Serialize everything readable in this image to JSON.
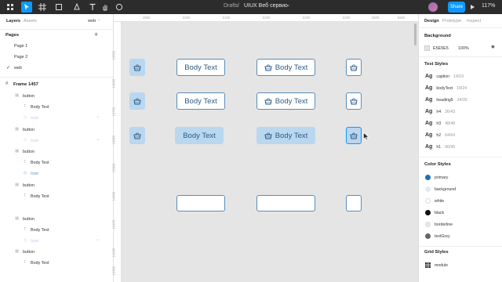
{
  "topbar": {
    "breadcrumb_drafts": "Drafts",
    "breadcrumb_sep": "/",
    "file_name": "UIUX Веб сервис",
    "share_label": "Share",
    "zoom": "117%",
    "chevron": "⌄"
  },
  "left_panel": {
    "tab_layers": "Layers",
    "tab_assets": "Assets",
    "current_page": "web",
    "pages_title": "Pages",
    "add": "+",
    "pages": [
      "Page 1",
      "Page 2",
      "web"
    ],
    "frame_name": "Frame 1457",
    "layers": [
      {
        "type": "button",
        "label": "button"
      },
      {
        "type": "text",
        "label": "Body Text"
      },
      {
        "type": "icon",
        "label": "Icon"
      },
      {
        "type": "button",
        "label": "button"
      },
      {
        "type": "icon",
        "label": "Icon"
      },
      {
        "type": "button",
        "label": "button"
      },
      {
        "type": "text",
        "label": "Body Text"
      },
      {
        "type": "icon",
        "label": "Icon"
      },
      {
        "type": "button",
        "label": "button"
      },
      {
        "type": "text",
        "label": "Body Text"
      },
      {
        "type": "button",
        "label": "button"
      },
      {
        "type": "text",
        "label": "Body Text"
      },
      {
        "type": "icon",
        "label": "Icon"
      },
      {
        "type": "button",
        "label": "button"
      },
      {
        "type": "text",
        "label": "Body Text"
      }
    ]
  },
  "rulers": {
    "top": [
      "4900",
      "5000",
      "5100",
      "5200",
      "5300",
      "5400",
      "5500",
      "5600"
    ],
    "left": [
      "13500",
      "13600",
      "13700",
      "13800",
      "13900",
      "14000",
      "14100",
      "14200",
      "14300",
      "14400"
    ]
  },
  "canvas": {
    "body_text": "Body Text",
    "accent": "#5b8db8",
    "fill": "#b9d7ef"
  },
  "right_panel": {
    "tab_design": "Design",
    "tab_prototype": "Prototype",
    "tab_inspect": "Inspect",
    "background_title": "Background",
    "bg_hex": "E5E5E5",
    "bg_opacity": "100%",
    "text_styles_title": "Text Styles",
    "text_styles": [
      {
        "name": "caption",
        "meta": "14/19"
      },
      {
        "name": "bodyText",
        "meta": "18/24"
      },
      {
        "name": "heading5",
        "meta": "24/30"
      },
      {
        "name": "h4",
        "meta": "36/43"
      },
      {
        "name": "h3",
        "meta": "48/48"
      },
      {
        "name": "h2",
        "meta": "64/64"
      },
      {
        "name": "h1",
        "meta": "96/96"
      }
    ],
    "ag": "Ag",
    "color_styles_title": "Color Styles",
    "color_styles": [
      {
        "name": "primary",
        "color": "#1e6fb8"
      },
      {
        "name": "background",
        "color": "#e5eaf2"
      },
      {
        "name": "white",
        "color": "#ffffff"
      },
      {
        "name": "black",
        "color": "#111111"
      },
      {
        "name": "borderline",
        "color": "#e8e8e8"
      },
      {
        "name": "textGrey",
        "color": "#666666"
      }
    ],
    "grid_styles_title": "Grid Styles",
    "grid_name": "module"
  }
}
